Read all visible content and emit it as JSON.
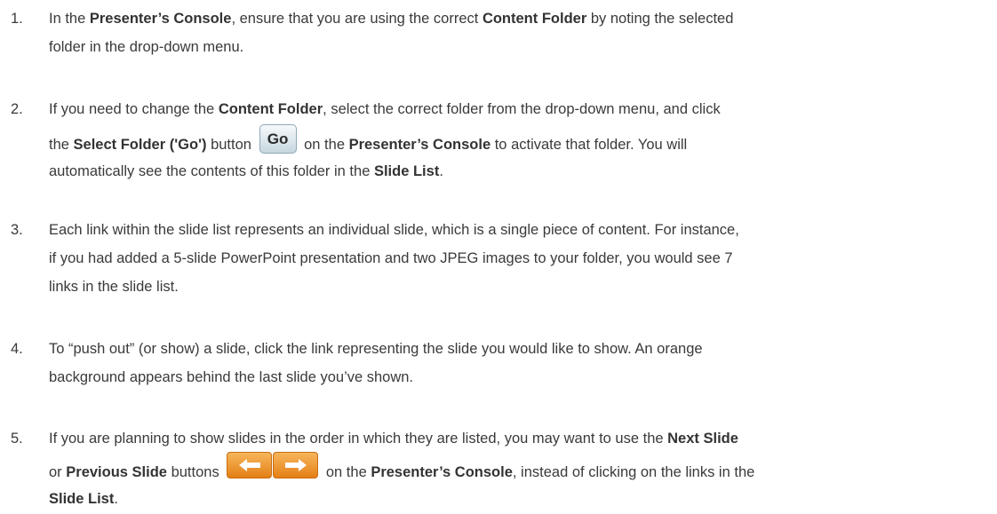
{
  "steps": [
    {
      "number": "1.",
      "parts": {
        "a": "In the ",
        "b1": "Presenter’s Console",
        "c": ", ensure that you are using the correct ",
        "b2": "Content Folder",
        "d": " by noting the selected",
        "e": "folder in the drop-down menu."
      }
    },
    {
      "number": "2.",
      "parts": {
        "a": "If you need to change the ",
        "b1": "Content Folder",
        "c": ", select the correct folder from the drop-down menu, and click",
        "d": "the ",
        "b2": "Select Folder ('Go')",
        "e": " button ",
        "go_label": "Go",
        "f": " on the ",
        "b3": "Presenter’s Console",
        "g": " to activate that folder.  You will",
        "h": "automatically see the contents of this folder in the ",
        "b4": "Slide List",
        "i": "."
      }
    },
    {
      "number": "3.",
      "lines": [
        "Each link within the slide list represents an individual slide, which is a single piece of content.  For instance,",
        "if you had added a 5-slide PowerPoint presentation and two JPEG images to your folder, you would see 7",
        "links in the slide list."
      ]
    },
    {
      "number": "4.",
      "lines": [
        "To “push out” (or show) a slide, click the link representing the slide you would like to show.  An orange",
        "background appears behind the last slide you’ve shown."
      ]
    },
    {
      "number": "5.",
      "parts": {
        "a": "If you are planning to show slides in the order in which they are listed, you may want to use the ",
        "b1": "Next Slide",
        "c": "or ",
        "b2": "Previous Slide",
        "d": " buttons ",
        "e": " on the ",
        "b3": "Presenter’s Console",
        "f": ", instead of clicking on the links in the",
        "b4": "Slide List",
        "g": "."
      }
    }
  ],
  "icons": {
    "go_button": "go-button-icon",
    "previous_button": "left-arrow-icon",
    "next_button": "right-arrow-icon"
  },
  "colors": {
    "text": "#3a3a3a",
    "arrow_orange": "#e98a1e",
    "go_blue_border": "#8fa9b8"
  }
}
